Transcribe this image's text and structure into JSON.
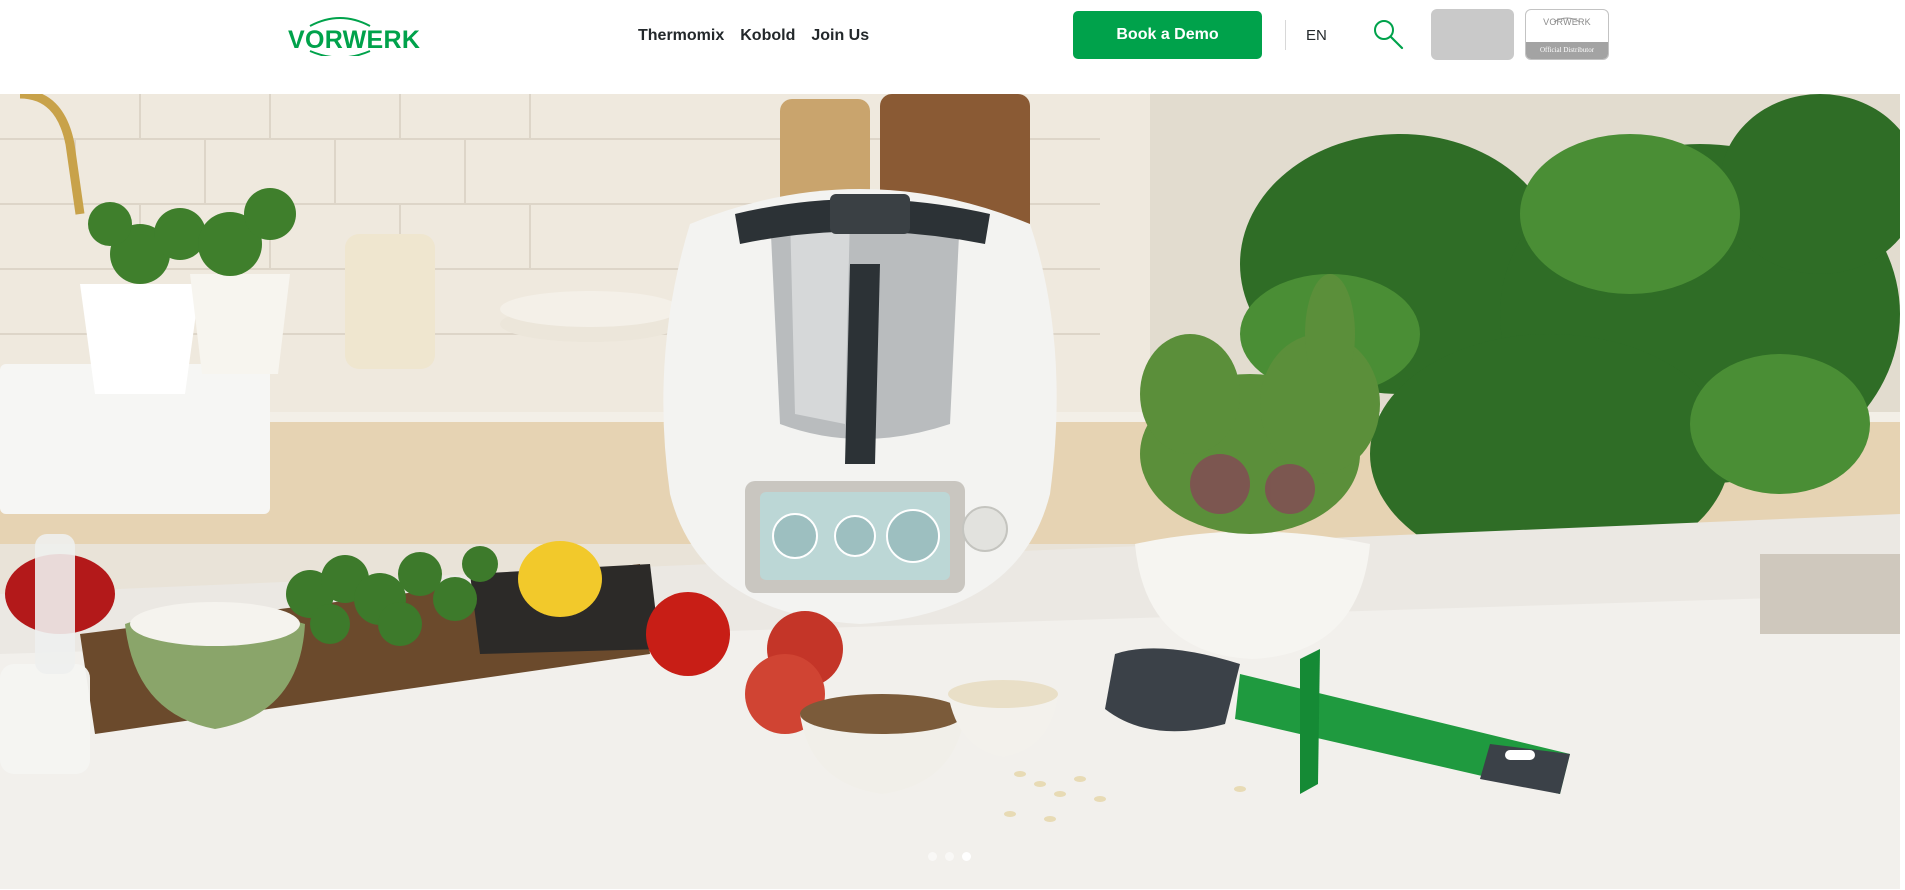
{
  "brand": {
    "logo_text": "VORWERK",
    "accent_color": "#00a24b"
  },
  "nav": {
    "items": [
      {
        "label": "Thermomix"
      },
      {
        "label": "Kobold"
      },
      {
        "label": "Join Us"
      }
    ]
  },
  "header": {
    "cta_label": "Book a Demo",
    "language": "EN",
    "search_icon": "search-icon",
    "distributor_badge": {
      "logo_text": "VORWERK",
      "caption": "Official Distributor"
    }
  },
  "hero": {
    "image_description_icon": "hero-image",
    "carousel": {
      "slide_count": 3,
      "active_slide": 3
    }
  }
}
